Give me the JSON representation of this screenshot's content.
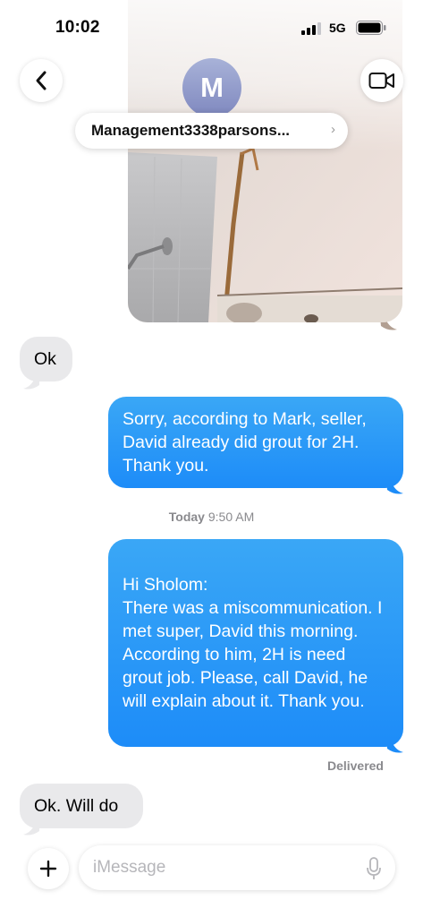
{
  "status_bar": {
    "time": "10:02",
    "network": "5G"
  },
  "header": {
    "avatar_initial": "M",
    "contact_name": "Management3338parsons...",
    "chevron": "›"
  },
  "messages": [
    {
      "type": "received",
      "text": "Ok"
    },
    {
      "type": "sent",
      "text": "Sorry, according to Mark, seller, David already did grout for 2H. Thank you."
    },
    {
      "type": "sent",
      "text": "Hi Sholom:\nThere was a miscommunication. I met super, David this morning. According to him, 2H is need grout job. Please, call David, he will explain about it. Thank you."
    },
    {
      "type": "received",
      "text": "Ok. Will do"
    }
  ],
  "timestamp": {
    "day": "Today",
    "time": "9:50 AM"
  },
  "delivered_label": "Delivered",
  "composer": {
    "placeholder": "iMessage"
  },
  "icons": [
    "signal-icon",
    "battery-icon",
    "back-chevron-icon",
    "video-camera-icon",
    "plus-icon",
    "microphone-icon"
  ],
  "colors": {
    "sent_bubble": "#1d8cf8",
    "received_bubble": "#e9e9eb"
  }
}
